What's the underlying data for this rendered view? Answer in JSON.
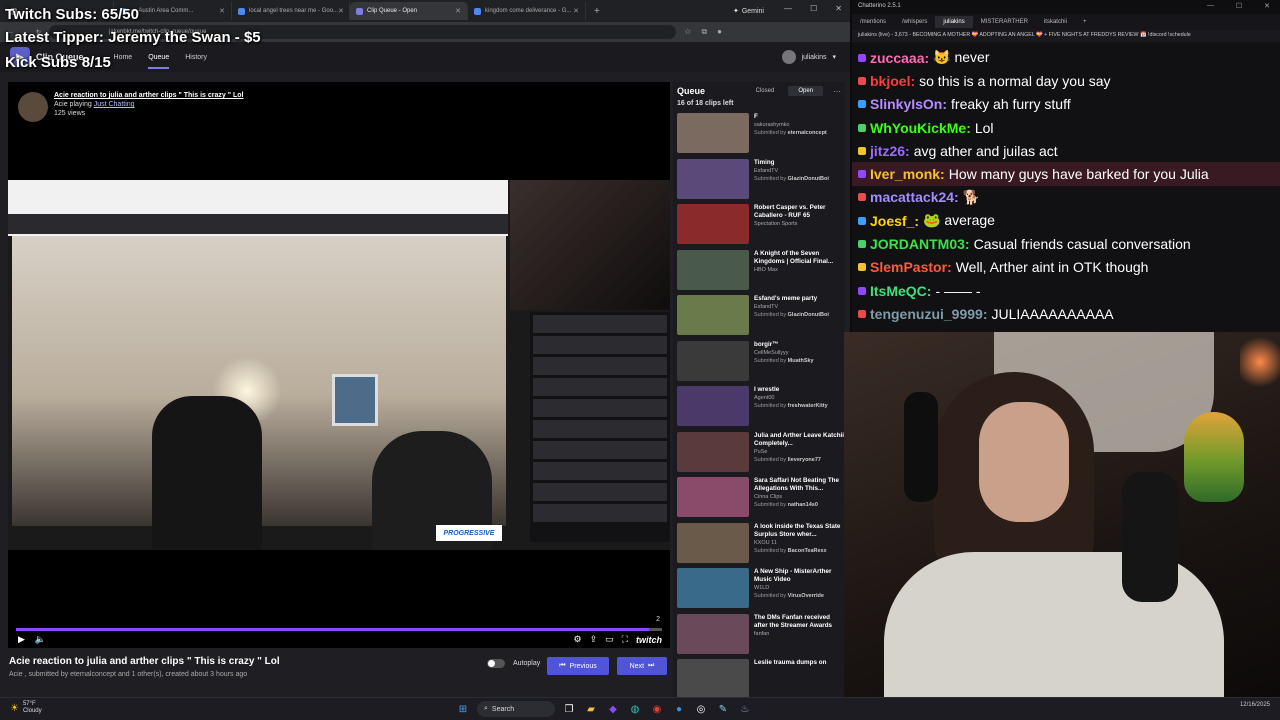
{
  "overlay": {
    "subs": "Twitch Subs: 65/50",
    "tipper": "Latest Tipper: Jeremy the Swan - $5",
    "kick": "Kick Subs 8/15"
  },
  "browser": {
    "tabs": [
      {
        "label": "— Austin Area Comm...",
        "active": false
      },
      {
        "label": "local angel trees near me - Goo...",
        "active": false
      },
      {
        "label": "Clip Queue - Open",
        "active": true
      },
      {
        "label": "kingdom come deliverance - G...",
        "active": false
      }
    ],
    "gemini_label": "Gemini",
    "url": "jakenbkt.me/twitch-clip-queue/queue"
  },
  "app": {
    "brand": "Clip Queue",
    "nav": [
      "Home",
      "Queue",
      "History"
    ],
    "user": "juliakins"
  },
  "clip": {
    "title": "Acie reaction to julia and arther clips \" This is crazy \" Lol",
    "playing_prefix": "Acie playing",
    "game": "Just Chatting",
    "views": "125 views",
    "promo": "PROGRESSIVE",
    "duration_label": "2",
    "bottom_title": "Acie reaction to julia and arther clips \" This is crazy \" Lol",
    "bottom_sub": "Acie , submitted by eternalconcept and 1 other(s), created about 3 hours ago",
    "autoplay_label": "Autoplay",
    "prev_label": "Previous",
    "next_label": "Next",
    "progress": 0.98,
    "twitch_label": "twitch"
  },
  "queue": {
    "title": "Queue",
    "closed_label": "Closed",
    "open_label": "Open",
    "count": "16 of 18 clips left",
    "items": [
      {
        "name": "F",
        "channel": "sakurashymko",
        "submitter": "eternalconcept",
        "color": "#7a6a60"
      },
      {
        "name": "Timing",
        "channel": "EsfandTV",
        "submitter": "GlazinDonutBoi",
        "color": "#5a4a7a"
      },
      {
        "name": "Robert Casper vs. Peter Caballero - RUF 65",
        "channel": "Spectation Sports",
        "submitter": "",
        "color": "#8a2a2a"
      },
      {
        "name": "A Knight of the Seven Kingdoms | Official Final...",
        "channel": "HBO Max",
        "submitter": "",
        "color": "#4a5a4a"
      },
      {
        "name": "Esfand's meme party",
        "channel": "EsfandTV",
        "submitter": "GlazinDonutBoi",
        "color": "#6a7a4a"
      },
      {
        "name": "borgir™",
        "channel": "CellMeSullyyy",
        "submitter": "MuathSky",
        "color": "#3a3a3a"
      },
      {
        "name": "I wrestle",
        "channel": "Agent00",
        "submitter": "freshwaterKitty",
        "color": "#4a3a6a"
      },
      {
        "name": "Julia and Arther Leave Katchii Completely...",
        "channel": "PuSe",
        "submitter": "lieveryone77",
        "color": "#5a3a3a"
      },
      {
        "name": "Sara Saffari Not Beating The Allegations With This...",
        "channel": "Cinna Clips",
        "submitter": "nathan14s0",
        "color": "#8a4a6a"
      },
      {
        "name": "A look inside the Texas State Surplus Store wher...",
        "channel": "KXOU 11",
        "submitter": "BaconTeaRexx",
        "color": "#6a5a4a"
      },
      {
        "name": "A New Ship - MisterArther Music Video",
        "channel": "W1LD",
        "submitter": "VirusOverride",
        "color": "#3a6a8a"
      },
      {
        "name": "The DMs Fanfan received after the Streamer Awards",
        "channel": "fanfan",
        "submitter": "",
        "color": "#6a4a5a"
      },
      {
        "name": "Leslie trauma dumps on",
        "channel": "",
        "submitter": "",
        "color": "#4a4a4a"
      }
    ]
  },
  "chat": {
    "title": "Chatterino 2.5.1",
    "tabs": [
      "/mentions",
      "/whispers",
      "juliakins",
      "MISTERARTHER",
      "itskatchii"
    ],
    "active_tab": "juliakins",
    "channel_bar": "juliakins (live) - 3,673 - BECOMING A MOTHER 💝 ADOPTING AN ANGEL 💝 + FIVE NIGHTS AT FREDDYS REVIEW 📅 !discord !schedule",
    "messages": [
      {
        "user": "zuccaaa:",
        "text": "😺 never",
        "color": "#ff69b4",
        "highlight": false
      },
      {
        "user": "bkjoel:",
        "text": "so this is a normal day you say",
        "color": "#ff3b3b",
        "highlight": false
      },
      {
        "user": "SlinkyIsOn:",
        "text": "freaky ah furry stuff",
        "color": "#b48cff",
        "highlight": false
      },
      {
        "user": "WhYouKickMe:",
        "text": "Lol",
        "color": "#39ff14",
        "highlight": false
      },
      {
        "user": "jitz26:",
        "text": "avg ather and juilas act",
        "color": "#9b6bff",
        "highlight": false
      },
      {
        "user": "Iver_monk:",
        "text": "How many guys have barked for you Julia",
        "color": "#f2c230",
        "highlight": true
      },
      {
        "user": "macattack24:",
        "text": "🐕",
        "color": "#a38cff",
        "highlight": false
      },
      {
        "user": "Joesf_:",
        "text": "🐸 average",
        "color": "#ffd700",
        "highlight": false
      },
      {
        "user": "JORDANTM03:",
        "text": "Casual friends casual conversation",
        "color": "#3ee04a",
        "highlight": false
      },
      {
        "user": "SlemPastor:",
        "text": "Well, Arther aint in OTK though",
        "color": "#ff5a3a",
        "highlight": false
      },
      {
        "user": "ItsMeQC:",
        "text": "- —— -",
        "color": "#3ee07a",
        "highlight": false
      },
      {
        "user": "tengenuzui_9999:",
        "text": "JULIAAAAAAAAAA",
        "color": "#7f9aa8",
        "highlight": false
      }
    ]
  },
  "taskbar": {
    "temp": "57°F",
    "weather": "Cloudy",
    "search_label": "Search",
    "tray_time": "12/16/2025"
  }
}
